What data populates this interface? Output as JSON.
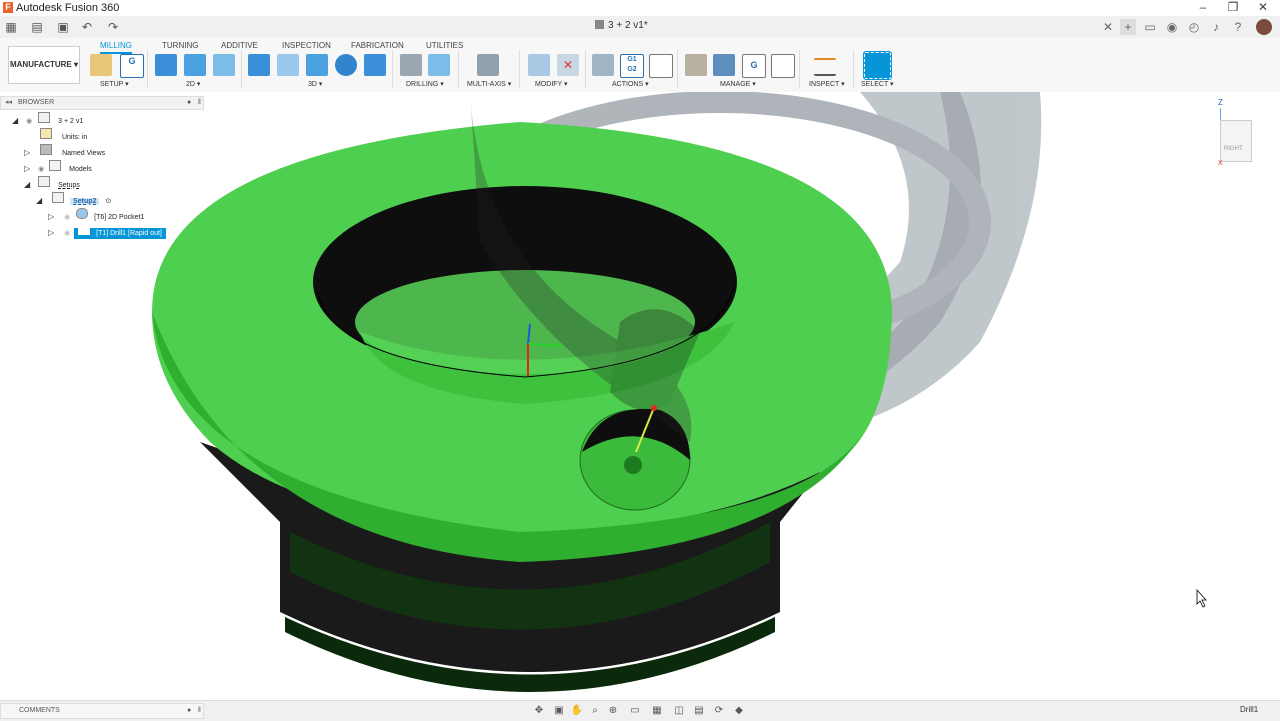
{
  "app": {
    "title": "Autodesk Fusion 360"
  },
  "document": {
    "tab_title": "3 + 2 v1*"
  },
  "workspace": {
    "label": "MANUFACTURE"
  },
  "ribbon": {
    "tabs": [
      "MILLING",
      "TURNING",
      "ADDITIVE",
      "INSPECTION",
      "FABRICATION",
      "UTILITIES"
    ],
    "active_tab": "MILLING",
    "groups": [
      "SETUP",
      "2D",
      "3D",
      "DRILLING",
      "MULTI-AXIS",
      "MODIFY",
      "ACTIONS",
      "MANAGE",
      "INSPECT",
      "SELECT"
    ]
  },
  "browser": {
    "title": "BROWSER",
    "items": [
      {
        "label": "3 + 2 v1"
      },
      {
        "label": "Units: in"
      },
      {
        "label": "Named Views"
      },
      {
        "label": "Models"
      },
      {
        "label": "Setups"
      },
      {
        "label": "Setup2"
      },
      {
        "label": "[T6] 2D Pocket1"
      },
      {
        "label": "[T1] Drill1 [Rapid out]"
      }
    ]
  },
  "viewcube": {
    "face": "RIGHT",
    "axis_z": "Z",
    "axis_x": "X"
  },
  "comments": {
    "label": "COMMENTS"
  },
  "status": {
    "active_operation": "Drill1"
  },
  "colors": {
    "accent": "#0696d7",
    "part_green": "#4fd04f",
    "part_dark": "#1a1a1a",
    "ghost_part": "#8e9aa2",
    "selected_row": "#0696d7"
  }
}
